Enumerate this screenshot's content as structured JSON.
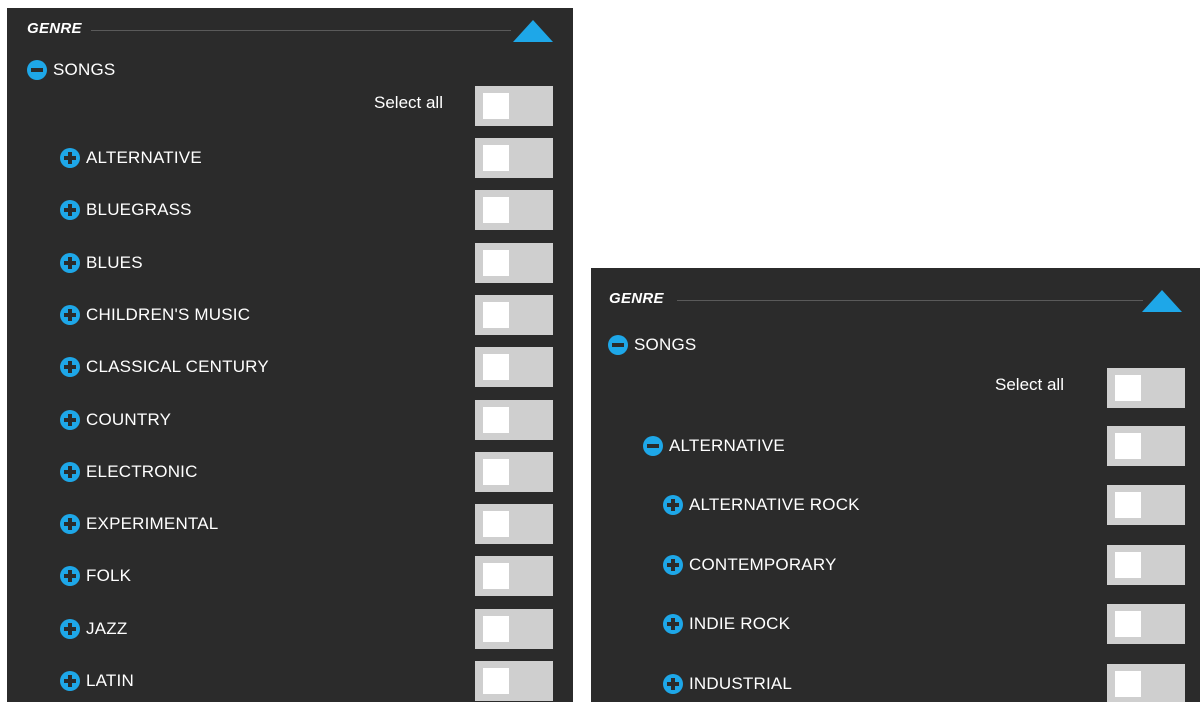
{
  "accent_color": "#1ea7e8",
  "left_panel": {
    "header_title": "GENRE",
    "root": {
      "label": "SONGS",
      "state": "expanded",
      "icon": "minus-circle-icon"
    },
    "select_all": {
      "label": "Select all",
      "on": false
    },
    "items": [
      {
        "label": "ALTERNATIVE",
        "state": "collapsed",
        "icon": "plus-circle-icon",
        "on": false
      },
      {
        "label": "BLUEGRASS",
        "state": "collapsed",
        "icon": "plus-circle-icon",
        "on": false
      },
      {
        "label": "BLUES",
        "state": "collapsed",
        "icon": "plus-circle-icon",
        "on": false
      },
      {
        "label": "CHILDREN'S MUSIC",
        "state": "collapsed",
        "icon": "plus-circle-icon",
        "on": false
      },
      {
        "label": "CLASSICAL CENTURY",
        "state": "collapsed",
        "icon": "plus-circle-icon",
        "on": false
      },
      {
        "label": "COUNTRY",
        "state": "collapsed",
        "icon": "plus-circle-icon",
        "on": false
      },
      {
        "label": "ELECTRONIC",
        "state": "collapsed",
        "icon": "plus-circle-icon",
        "on": false
      },
      {
        "label": "EXPERIMENTAL",
        "state": "collapsed",
        "icon": "plus-circle-icon",
        "on": false
      },
      {
        "label": "FOLK",
        "state": "collapsed",
        "icon": "plus-circle-icon",
        "on": false
      },
      {
        "label": "JAZZ",
        "state": "collapsed",
        "icon": "plus-circle-icon",
        "on": false
      },
      {
        "label": "LATIN",
        "state": "collapsed",
        "icon": "plus-circle-icon",
        "on": false
      }
    ]
  },
  "right_panel": {
    "header_title": "GENRE",
    "root": {
      "label": "SONGS",
      "state": "expanded",
      "icon": "minus-circle-icon"
    },
    "select_all": {
      "label": "Select all",
      "on": false
    },
    "expanded_item": {
      "label": "ALTERNATIVE",
      "state": "expanded",
      "icon": "minus-circle-icon",
      "on": false
    },
    "sub_items": [
      {
        "label": "ALTERNATIVE ROCK",
        "state": "collapsed",
        "icon": "plus-circle-icon",
        "on": false
      },
      {
        "label": "CONTEMPORARY",
        "state": "collapsed",
        "icon": "plus-circle-icon",
        "on": false
      },
      {
        "label": "INDIE ROCK",
        "state": "collapsed",
        "icon": "plus-circle-icon",
        "on": false
      },
      {
        "label": "INDUSTRIAL",
        "state": "collapsed",
        "icon": "plus-circle-icon",
        "on": false
      }
    ]
  }
}
